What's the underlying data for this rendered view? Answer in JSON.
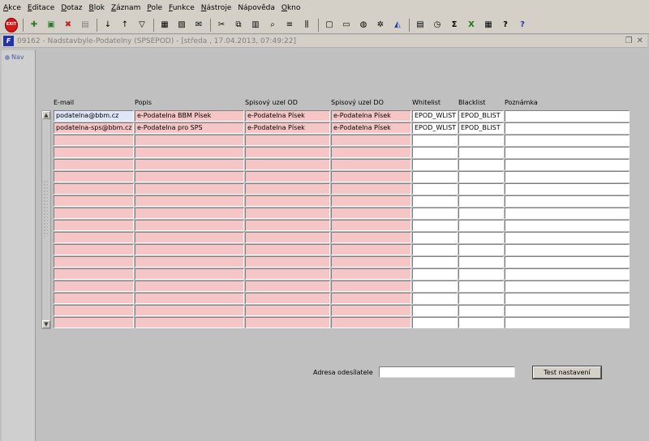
{
  "menu": [
    {
      "key": "A",
      "rest": "kce"
    },
    {
      "key": "E",
      "rest": "ditace"
    },
    {
      "key": "D",
      "rest": "otaz"
    },
    {
      "key": "B",
      "rest": "lok"
    },
    {
      "key": "Z",
      "rest": "áznam"
    },
    {
      "key": "P",
      "rest": "ole"
    },
    {
      "key": "F",
      "rest": "unkce"
    },
    {
      "key": "N",
      "rest": "ástroje"
    },
    {
      "key": "",
      "rest": "Nápověda"
    },
    {
      "key": "O",
      "rest": "kno"
    }
  ],
  "toolbar": {
    "exit_label": "EXIT"
  },
  "window": {
    "title": "09162 - Nadstavbyle-Podatelny (SPSEPOD) - [středa , 17.04.2013, 07:49:22]",
    "icon_letter": "F"
  },
  "nav": {
    "tab_label": "Nav"
  },
  "grid": {
    "headers": [
      "E-mail",
      "Popis",
      "Spisový uzel OD",
      "Spisový uzel DO",
      "Whitelist",
      "Blacklist",
      "Poznámka"
    ],
    "rows": [
      [
        "podatelna@bbm.cz",
        "e-Podatelna BBM Písek",
        "e-Podatelna Písek",
        "e-Podatelna Písek",
        "EPOD_WLIST",
        "EPOD_BLIST",
        ""
      ],
      [
        "podatelna-sps@bbm.cz",
        "e-Podatelna pro SPS",
        "e-Podatelna Písek",
        "e-Podatelna Písek",
        "EPOD_WLIST",
        "EPOD_BLIST",
        ""
      ],
      [
        "",
        "",
        "",
        "",
        "",
        "",
        ""
      ],
      [
        "",
        "",
        "",
        "",
        "",
        "",
        ""
      ],
      [
        "",
        "",
        "",
        "",
        "",
        "",
        ""
      ],
      [
        "",
        "",
        "",
        "",
        "",
        "",
        ""
      ],
      [
        "",
        "",
        "",
        "",
        "",
        "",
        ""
      ],
      [
        "",
        "",
        "",
        "",
        "",
        "",
        ""
      ],
      [
        "",
        "",
        "",
        "",
        "",
        "",
        ""
      ],
      [
        "",
        "",
        "",
        "",
        "",
        "",
        ""
      ],
      [
        "",
        "",
        "",
        "",
        "",
        "",
        ""
      ],
      [
        "",
        "",
        "",
        "",
        "",
        "",
        ""
      ],
      [
        "",
        "",
        "",
        "",
        "",
        "",
        ""
      ],
      [
        "",
        "",
        "",
        "",
        "",
        "",
        ""
      ],
      [
        "",
        "",
        "",
        "",
        "",
        "",
        ""
      ],
      [
        "",
        "",
        "",
        "",
        "",
        "",
        ""
      ],
      [
        "",
        "",
        "",
        "",
        "",
        "",
        ""
      ],
      [
        "",
        "",
        "",
        "",
        "",
        "",
        ""
      ]
    ]
  },
  "form": {
    "address_label": "Adresa odesílatele",
    "address_value": "",
    "test_button": "Test nastavení"
  }
}
